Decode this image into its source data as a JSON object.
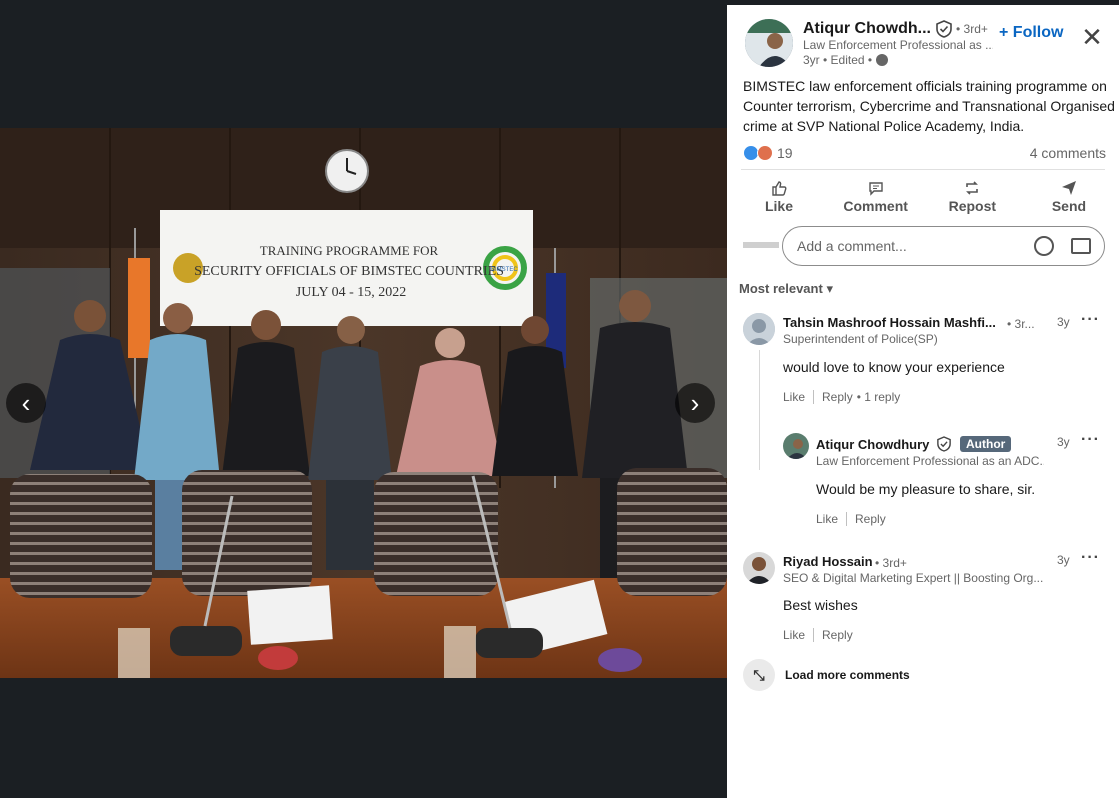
{
  "post": {
    "author_name": "Atiqur Chowdh...",
    "degree": "• 3rd+",
    "follow_label": "+ Follow",
    "headline": "Law Enforcement Professional as ...",
    "meta": "3yr • Edited •",
    "text": "BIMSTEC law enforcement officials training programme on Counter terrorism, Cybercrime and Transnational Organised crime at SVP National Police Academy, India.",
    "reaction_count": "19",
    "comments_count": "4 comments"
  },
  "photo": {
    "banner_line1": "TRAINING PROGRAMME FOR",
    "banner_line2": "SECURITY OFFICIALS OF BIMSTEC COUNTRIES",
    "banner_line3": "JULY 04 - 15, 2022",
    "bimstec_label": "BIMSTEC"
  },
  "actions": {
    "like": "Like",
    "comment": "Comment",
    "repost": "Repost",
    "send": "Send"
  },
  "comment_box": {
    "placeholder": "Add a comment..."
  },
  "sort_label": "Most relevant",
  "comments": [
    {
      "name": "Tahsin Mashroof Hossain Mashfi...",
      "degree": "• 3r...",
      "headline": "Superintendent of Police(SP)",
      "time": "3y",
      "body": "would love to know your experience",
      "like": "Like",
      "reply": "Reply",
      "replies": "• 1 reply"
    },
    {
      "name": "Atiqur Chowdhury",
      "badge": "Author",
      "headline": "Law Enforcement Professional as an ADC...",
      "time": "3y",
      "body": "Would be my pleasure to share, sir.",
      "like": "Like",
      "reply": "Reply"
    },
    {
      "name": "Riyad Hossain",
      "degree": "• 3rd+",
      "headline": "SEO & Digital Marketing Expert || Boosting Org...",
      "time": "3y",
      "body": "Best wishes",
      "like": "Like",
      "reply": "Reply"
    }
  ],
  "load_more": "Load more comments",
  "colors": {
    "accent": "#0a66c2",
    "media_bg": "#1b1f23",
    "author_badge": "#56687a"
  }
}
